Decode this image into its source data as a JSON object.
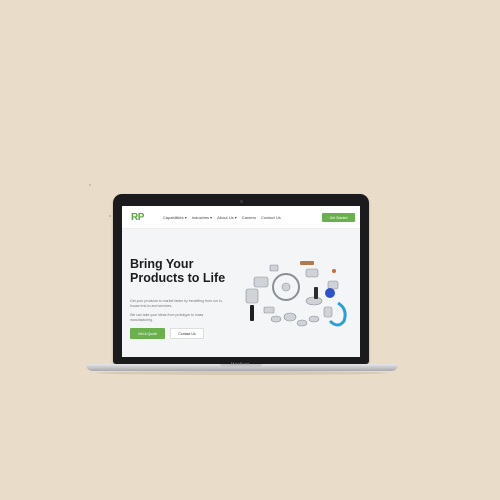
{
  "site": {
    "logo": "RP",
    "nav": [
      "Capabilities ▾",
      "Industries ▾",
      "About Us ▾",
      "Careers",
      "Contact Us"
    ],
    "nav_cta": "Get Started",
    "hero": {
      "title_line1": "Bring Your",
      "title_line2": "Products to Life",
      "para1_line1": "Get your products to market faster by benefiting from our in-",
      "para1_line2": "house end-to-end services.",
      "para2_line1": "We can take your ideas from prototype to mass",
      "para2_line2": "manufacturing.",
      "primary_button": "Get A Quote",
      "secondary_button": "Contact Us"
    }
  },
  "device": {
    "brand": "MacBook"
  },
  "colors": {
    "background": "#e9dcc9",
    "accent": "#6ab04c",
    "logo": "#5aa83a"
  }
}
